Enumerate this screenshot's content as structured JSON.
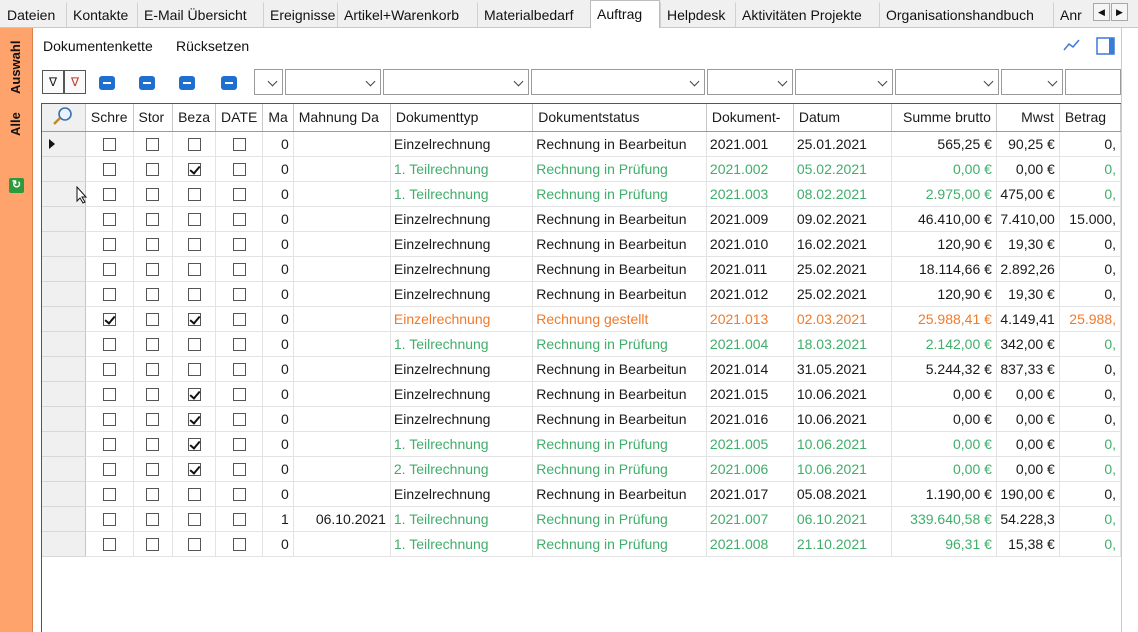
{
  "tabs": [
    {
      "label": "Dateien",
      "active": false
    },
    {
      "label": "Kontakte",
      "active": false
    },
    {
      "label": "E-Mail Übersicht",
      "active": false
    },
    {
      "label": "Ereignisse",
      "active": false
    },
    {
      "label": "Artikel+Warenkorb",
      "active": false
    },
    {
      "label": "Materialbedarf",
      "active": false
    },
    {
      "label": "Auftrag",
      "active": true
    },
    {
      "label": "Helpdesk",
      "active": false
    },
    {
      "label": "Aktivitäten Projekte",
      "active": false
    },
    {
      "label": "Organisationshandbuch",
      "active": false
    },
    {
      "label": "Anr",
      "active": false
    }
  ],
  "side": {
    "tab_auswahl": "Auswahl",
    "tab_alle": "Alle",
    "refresh_icon": "refresh-icon"
  },
  "toolbar": {
    "dokumentenkette": "Dokumentenkette",
    "ruecksetzen": "Rücksetzen",
    "chart_icon": "line-chart-icon",
    "panel_icon": "panel-icon"
  },
  "columns": [
    "Schre",
    "Stor",
    "Beza",
    "DATE",
    "Ma",
    "Mahnung Da",
    "Dokumenttyp",
    "Dokumentstatus",
    "Dokument-",
    "Datum",
    "Summe brutto",
    "Mwst",
    "Betrag"
  ],
  "colors": {
    "green": "#3fae6a",
    "orange": "#f07a2a",
    "side_panel": "#ffa36c",
    "filter_blue": "#1e6fd0"
  },
  "rows": [
    {
      "current": true,
      "style": "normal",
      "schre": false,
      "stor": false,
      "beza": false,
      "date": false,
      "ma": "0",
      "mahnung": "",
      "typ": "Einzelrechnung",
      "status": "Rechnung in Bearbeitun",
      "nr": "2021.001",
      "datum": "25.01.2021",
      "brutto": "565,25 €",
      "mwst": "90,25 €",
      "betrag": "0,"
    },
    {
      "current": false,
      "style": "green",
      "schre": false,
      "stor": false,
      "beza": true,
      "date": false,
      "ma": "0",
      "mahnung": "",
      "typ": "1. Teilrechnung",
      "status": "Rechnung in Prüfung",
      "nr": "2021.002",
      "datum": "05.02.2021",
      "brutto": "0,00 €",
      "mwst": "0,00 €",
      "betrag": "0,"
    },
    {
      "current": false,
      "style": "green",
      "schre": false,
      "stor": false,
      "beza": false,
      "date": false,
      "ma": "0",
      "mahnung": "",
      "typ": "1. Teilrechnung",
      "status": "Rechnung in Prüfung",
      "nr": "2021.003",
      "datum": "08.02.2021",
      "brutto": "2.975,00 €",
      "mwst": "475,00 €",
      "betrag": "0,"
    },
    {
      "current": false,
      "style": "normal",
      "schre": false,
      "stor": false,
      "beza": false,
      "date": false,
      "ma": "0",
      "mahnung": "",
      "typ": "Einzelrechnung",
      "status": "Rechnung in Bearbeitun",
      "nr": "2021.009",
      "datum": "09.02.2021",
      "brutto": "46.410,00 €",
      "mwst": "7.410,00",
      "betrag": "15.000,"
    },
    {
      "current": false,
      "style": "normal",
      "schre": false,
      "stor": false,
      "beza": false,
      "date": false,
      "ma": "0",
      "mahnung": "",
      "typ": "Einzelrechnung",
      "status": "Rechnung in Bearbeitun",
      "nr": "2021.010",
      "datum": "16.02.2021",
      "brutto": "120,90 €",
      "mwst": "19,30 €",
      "betrag": "0,"
    },
    {
      "current": false,
      "style": "normal",
      "schre": false,
      "stor": false,
      "beza": false,
      "date": false,
      "ma": "0",
      "mahnung": "",
      "typ": "Einzelrechnung",
      "status": "Rechnung in Bearbeitun",
      "nr": "2021.011",
      "datum": "25.02.2021",
      "brutto": "18.114,66 €",
      "mwst": "2.892,26",
      "betrag": "0,"
    },
    {
      "current": false,
      "style": "normal",
      "schre": false,
      "stor": false,
      "beza": false,
      "date": false,
      "ma": "0",
      "mahnung": "",
      "typ": "Einzelrechnung",
      "status": "Rechnung in Bearbeitun",
      "nr": "2021.012",
      "datum": "25.02.2021",
      "brutto": "120,90 €",
      "mwst": "19,30 €",
      "betrag": "0,"
    },
    {
      "current": false,
      "style": "orange",
      "schre": true,
      "stor": false,
      "beza": true,
      "date": false,
      "ma": "0",
      "mahnung": "",
      "typ": "Einzelrechnung",
      "status": "Rechnung gestellt",
      "nr": "2021.013",
      "datum": "02.03.2021",
      "brutto": "25.988,41 €",
      "mwst": "4.149,41",
      "betrag": "25.988,"
    },
    {
      "current": false,
      "style": "green",
      "schre": false,
      "stor": false,
      "beza": false,
      "date": false,
      "ma": "0",
      "mahnung": "",
      "typ": "1. Teilrechnung",
      "status": "Rechnung in Prüfung",
      "nr": "2021.004",
      "datum": "18.03.2021",
      "brutto": "2.142,00 €",
      "mwst": "342,00 €",
      "betrag": "0,"
    },
    {
      "current": false,
      "style": "normal",
      "schre": false,
      "stor": false,
      "beza": false,
      "date": false,
      "ma": "0",
      "mahnung": "",
      "typ": "Einzelrechnung",
      "status": "Rechnung in Bearbeitun",
      "nr": "2021.014",
      "datum": "31.05.2021",
      "brutto": "5.244,32 €",
      "mwst": "837,33 €",
      "betrag": "0,"
    },
    {
      "current": false,
      "style": "normal",
      "schre": false,
      "stor": false,
      "beza": true,
      "date": false,
      "ma": "0",
      "mahnung": "",
      "typ": "Einzelrechnung",
      "status": "Rechnung in Bearbeitun",
      "nr": "2021.015",
      "datum": "10.06.2021",
      "brutto": "0,00 €",
      "mwst": "0,00 €",
      "betrag": "0,"
    },
    {
      "current": false,
      "style": "normal",
      "schre": false,
      "stor": false,
      "beza": true,
      "date": false,
      "ma": "0",
      "mahnung": "",
      "typ": "Einzelrechnung",
      "status": "Rechnung in Bearbeitun",
      "nr": "2021.016",
      "datum": "10.06.2021",
      "brutto": "0,00 €",
      "mwst": "0,00 €",
      "betrag": "0,"
    },
    {
      "current": false,
      "style": "green",
      "schre": false,
      "stor": false,
      "beza": true,
      "date": false,
      "ma": "0",
      "mahnung": "",
      "typ": "1. Teilrechnung",
      "status": "Rechnung in Prüfung",
      "nr": "2021.005",
      "datum": "10.06.2021",
      "brutto": "0,00 €",
      "mwst": "0,00 €",
      "betrag": "0,"
    },
    {
      "current": false,
      "style": "green",
      "schre": false,
      "stor": false,
      "beza": true,
      "date": false,
      "ma": "0",
      "mahnung": "",
      "typ": "2. Teilrechnung",
      "status": "Rechnung in Prüfung",
      "nr": "2021.006",
      "datum": "10.06.2021",
      "brutto": "0,00 €",
      "mwst": "0,00 €",
      "betrag": "0,"
    },
    {
      "current": false,
      "style": "normal",
      "schre": false,
      "stor": false,
      "beza": false,
      "date": false,
      "ma": "0",
      "mahnung": "",
      "typ": "Einzelrechnung",
      "status": "Rechnung in Bearbeitun",
      "nr": "2021.017",
      "datum": "05.08.2021",
      "brutto": "1.190,00 €",
      "mwst": "190,00 €",
      "betrag": "0,"
    },
    {
      "current": false,
      "style": "green",
      "schre": false,
      "stor": false,
      "beza": false,
      "date": false,
      "ma": "1",
      "mahnung": "06.10.2021",
      "typ": "1. Teilrechnung",
      "status": "Rechnung in Prüfung",
      "nr": "2021.007",
      "datum": "06.10.2021",
      "brutto": "339.640,58 €",
      "mwst": "54.228,3",
      "betrag": "0,"
    },
    {
      "current": false,
      "style": "green",
      "schre": false,
      "stor": false,
      "beza": false,
      "date": false,
      "ma": "0",
      "mahnung": "",
      "typ": "1. Teilrechnung",
      "status": "Rechnung in Prüfung",
      "nr": "2021.008",
      "datum": "21.10.2021",
      "brutto": "96,31 €",
      "mwst": "15,38 €",
      "betrag": "0,"
    }
  ]
}
